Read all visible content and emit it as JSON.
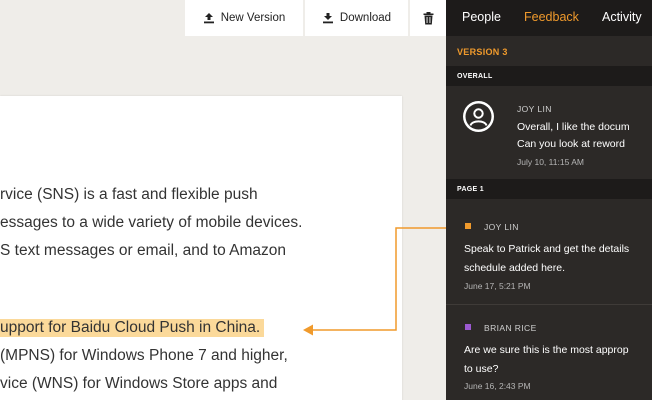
{
  "toolbar": {
    "new_version_label": "New Version",
    "download_label": "Download",
    "icons": [
      "upload-icon",
      "download-icon",
      "trash-icon"
    ]
  },
  "document": {
    "lines": [
      "rvice (SNS) is a fast and flexible push",
      "essages to a wide variety of mobile devices.",
      "S text messages or email, and to Amazon",
      "upport for Baidu Cloud Push in China.",
      "(MPNS) for Windows Phone 7 and higher,",
      "vice (WNS) for Windows Store apps and"
    ],
    "highlight_color": "#fbd99a"
  },
  "panel": {
    "tabs": [
      {
        "label": "People",
        "active": false
      },
      {
        "label": "Feedback",
        "active": true
      },
      {
        "label": "Activity",
        "active": false
      }
    ],
    "version_label": "VERSION 3",
    "overall_label": "OVERALL",
    "page_label": "PAGE 1",
    "overall_comment": {
      "author": "JOY LIN",
      "line1": "Overall, I like the docum",
      "line2": "Can you look at reword",
      "date": "July 10, 11:15 AM"
    },
    "page_comments": [
      {
        "author": "JOY LIN",
        "color": "#f09a2c",
        "line1": "Speak to Patrick and get the details",
        "line2": "schedule added here.",
        "date": "June 17, 5:21 PM"
      },
      {
        "author": "BRIAN RICE",
        "color": "#9b59d0",
        "line1": "Are we sure this is the most approp",
        "line2": "to use?",
        "date": "June 16, 2:43 PM"
      }
    ],
    "accent_color": "#f09a2c"
  }
}
